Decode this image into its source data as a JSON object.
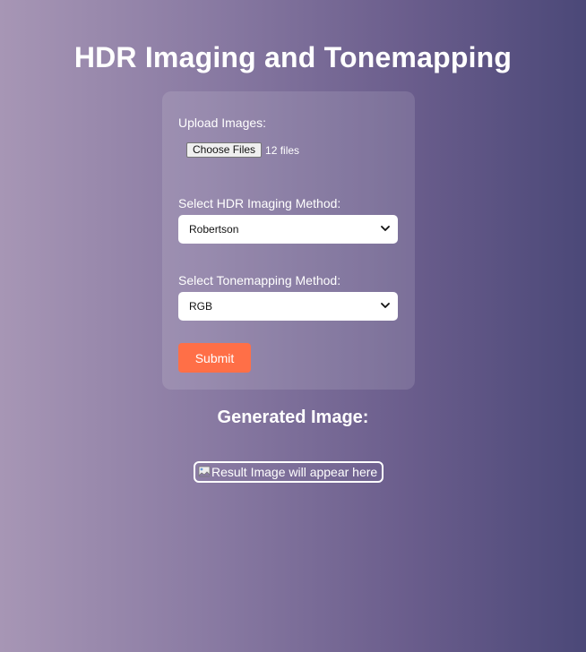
{
  "page": {
    "title": "HDR Imaging and Tonemapping"
  },
  "form": {
    "upload_label": "Upload Images:",
    "file_button_label": "Choose Files",
    "file_count": "12 files",
    "hdr_label": "Select HDR Imaging Method:",
    "hdr_selected": "Robertson",
    "tonemap_label": "Select Tonemapping Method:",
    "tonemap_selected": "RGB",
    "submit_label": "Submit"
  },
  "result": {
    "heading": "Generated Image:",
    "image_alt": "Result Image will appear here"
  },
  "colors": {
    "background_start": "#a796b5",
    "background_end": "#4b4878",
    "submit": "#ff6f47",
    "text": "#ffffff"
  },
  "icons": {
    "select_arrow": "chevron-down-icon",
    "missing_image": "broken-image-icon"
  }
}
